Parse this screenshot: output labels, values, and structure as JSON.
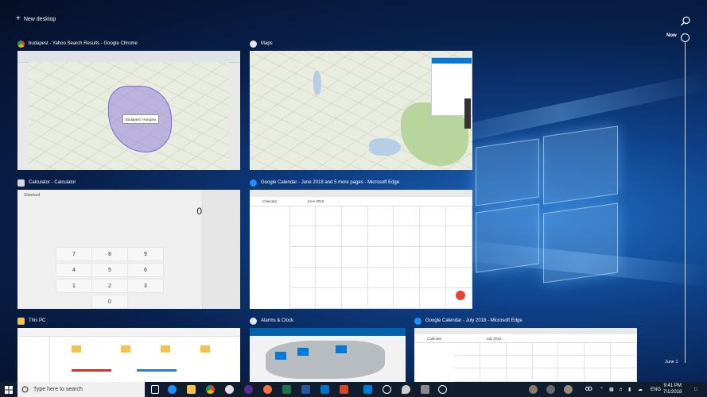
{
  "header": {
    "new_desktop_label": "New desktop"
  },
  "timeline": {
    "now_label": "Now",
    "bottom_label": "June 1"
  },
  "windows": [
    {
      "title": "budapest - Yahoo Search Results - Google Chrome",
      "icon": "chrome-icon",
      "map_label": "Budapest, Hungary"
    },
    {
      "title": "Maps",
      "icon": "maps-icon"
    },
    {
      "title": "Calculator - Calculator",
      "icon": "calculator-icon",
      "mode": "Standard",
      "display": "0"
    },
    {
      "title": "Google Calendar - June 2018 and 5 more pages - Microsoft Edge",
      "icon": "edge-icon",
      "header_label": "Calendar",
      "month_label": "June 2018"
    },
    {
      "title": "This PC",
      "icon": "folder-icon"
    },
    {
      "title": "Alarms & Clock",
      "icon": "alarm-clock-icon"
    },
    {
      "title": "Google Calendar - July 2018 - Microsoft Edge",
      "icon": "edge-icon",
      "header_label": "Calendar",
      "month_label": "July 2018"
    }
  ],
  "calculator": {
    "keys": [
      "7",
      "8",
      "9",
      "4",
      "5",
      "6",
      "1",
      "2",
      "3",
      "0"
    ]
  },
  "taskbar": {
    "search_placeholder": "Type here to search",
    "apps": [
      "task-view-icon",
      "edge-icon",
      "file-explorer-icon",
      "chrome-icon",
      "maps-icon",
      "firefox-icon",
      "excel-icon",
      "word-icon",
      "outlook-icon",
      "powerpoint-icon",
      "store-icon",
      "settings-icon",
      "maps-pin-icon",
      "calculator-icon",
      "alarm-icon"
    ],
    "language": "ENG",
    "time": "9:41 PM",
    "date": "7/1/2018"
  },
  "colors": {
    "accent": "#0078d7",
    "taskbar": "#101d2e"
  }
}
